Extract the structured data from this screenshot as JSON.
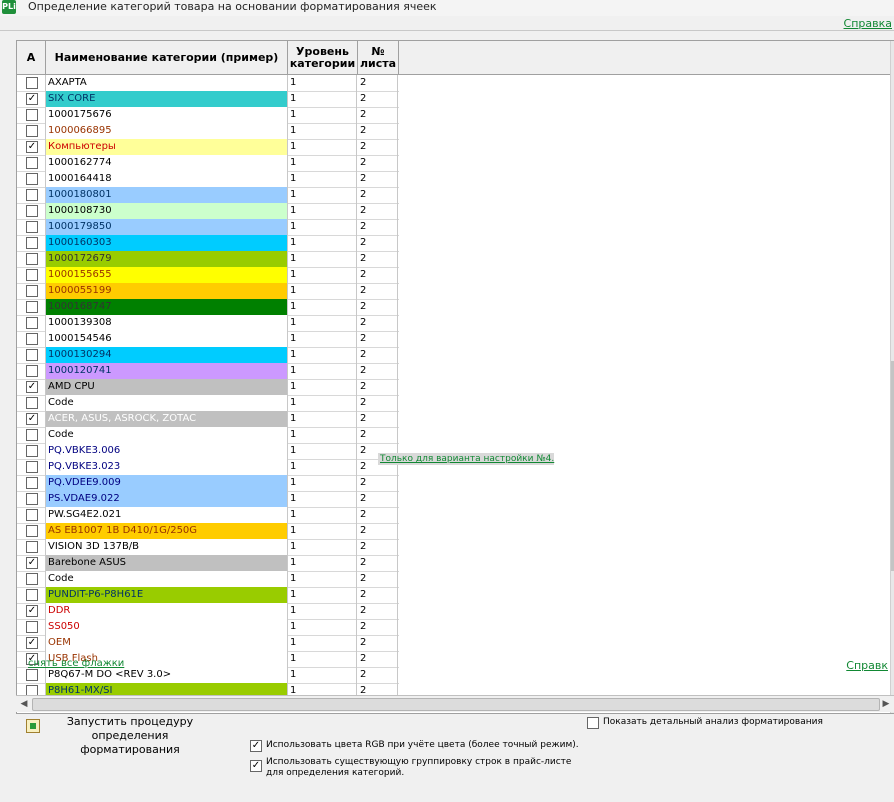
{
  "window": {
    "title": "Определение категорий товара на основании форматирования ячеек",
    "icon_text": "PLi"
  },
  "help_link_top": "Справка",
  "grid": {
    "columns": [
      {
        "label": "A"
      },
      {
        "label": "Наименование категории (пример)"
      },
      {
        "label": "Уровень категории"
      },
      {
        "label": "№ листа"
      }
    ],
    "rows": [
      {
        "checked": false,
        "name": "AXAPTA",
        "level": "1",
        "sheet": "2",
        "bg": "#ffffff",
        "fg": "#000000"
      },
      {
        "checked": true,
        "name": "SIX CORE",
        "level": "1",
        "sheet": "2",
        "bg": "#33cccc",
        "fg": "#003366"
      },
      {
        "checked": false,
        "name": "1000175676",
        "level": "1",
        "sheet": "2",
        "bg": "#ffffff",
        "fg": "#000000"
      },
      {
        "checked": false,
        "name": "1000066895",
        "level": "1",
        "sheet": "2",
        "bg": "#ffffff",
        "fg": "#993300"
      },
      {
        "checked": true,
        "name": "Компьютеры",
        "level": "1",
        "sheet": "2",
        "bg": "#ffff99",
        "fg": "#cc0000"
      },
      {
        "checked": false,
        "name": "1000162774",
        "level": "1",
        "sheet": "2",
        "bg": "#ffffff",
        "fg": "#000000"
      },
      {
        "checked": false,
        "name": "1000164418",
        "level": "1",
        "sheet": "2",
        "bg": "#ffffff",
        "fg": "#000000"
      },
      {
        "checked": false,
        "name": "1000180801",
        "level": "1",
        "sheet": "2",
        "bg": "#99ccff",
        "fg": "#003366"
      },
      {
        "checked": false,
        "name": "1000108730",
        "level": "1",
        "sheet": "2",
        "bg": "#ccffcc",
        "fg": "#000000"
      },
      {
        "checked": false,
        "name": "1000179850",
        "level": "1",
        "sheet": "2",
        "bg": "#99ccff",
        "fg": "#003366"
      },
      {
        "checked": false,
        "name": "1000160303",
        "level": "1",
        "sheet": "2",
        "bg": "#00ccff",
        "fg": "#003366"
      },
      {
        "checked": false,
        "name": "1000172679",
        "level": "1",
        "sheet": "2",
        "bg": "#99cc00",
        "fg": "#333333"
      },
      {
        "checked": false,
        "name": "1000155655",
        "level": "1",
        "sheet": "2",
        "bg": "#ffff00",
        "fg": "#993300"
      },
      {
        "checked": false,
        "name": "1000055199",
        "level": "1",
        "sheet": "2",
        "bg": "#ffcc00",
        "fg": "#993300"
      },
      {
        "checked": false,
        "name": "1000168747",
        "level": "1",
        "sheet": "2",
        "bg": "#008000",
        "fg": "#333333"
      },
      {
        "checked": false,
        "name": "1000139308",
        "level": "1",
        "sheet": "2",
        "bg": "#ffffff",
        "fg": "#000000"
      },
      {
        "checked": false,
        "name": "1000154546",
        "level": "1",
        "sheet": "2",
        "bg": "#ffffff",
        "fg": "#000000"
      },
      {
        "checked": false,
        "name": "1000130294",
        "level": "1",
        "sheet": "2",
        "bg": "#00ccff",
        "fg": "#003366"
      },
      {
        "checked": false,
        "name": "1000120741",
        "level": "1",
        "sheet": "2",
        "bg": "#cc99ff",
        "fg": "#003366"
      },
      {
        "checked": true,
        "name": "AMD CPU",
        "level": "1",
        "sheet": "2",
        "bg": "#c0c0c0",
        "fg": "#000000"
      },
      {
        "checked": false,
        "name": "Code",
        "level": "1",
        "sheet": "2",
        "bg": "#ffffff",
        "fg": "#000000"
      },
      {
        "checked": true,
        "name": "ACER, ASUS, ASROCK, ZOTAC",
        "level": "1",
        "sheet": "2",
        "bg": "#c0c0c0",
        "fg": "#ffffff"
      },
      {
        "checked": false,
        "name": "Code",
        "level": "1",
        "sheet": "2",
        "bg": "#ffffff",
        "fg": "#000000"
      },
      {
        "checked": false,
        "name": "PQ.VBKE3.006",
        "level": "1",
        "sheet": "2",
        "bg": "#ffffff",
        "fg": "#000080"
      },
      {
        "checked": false,
        "name": "PQ.VBKE3.023",
        "level": "1",
        "sheet": "2",
        "bg": "#ffffff",
        "fg": "#000080"
      },
      {
        "checked": false,
        "name": "PQ.VDEE9.009",
        "level": "1",
        "sheet": "2",
        "bg": "#99ccff",
        "fg": "#000080"
      },
      {
        "checked": false,
        "name": "PS.VDAE9.022",
        "level": "1",
        "sheet": "2",
        "bg": "#99ccff",
        "fg": "#000080"
      },
      {
        "checked": false,
        "name": "PW.SG4E2.021",
        "level": "1",
        "sheet": "2",
        "bg": "#ffffff",
        "fg": "#000000"
      },
      {
        "checked": false,
        "name": "AS EB1007 1B D410/1G/250G",
        "level": "1",
        "sheet": "2",
        "bg": "#ffcc00",
        "fg": "#993300"
      },
      {
        "checked": false,
        "name": "VISION 3D 137B/B",
        "level": "1",
        "sheet": "2",
        "bg": "#ffffff",
        "fg": "#000000"
      },
      {
        "checked": true,
        "name": "Barebone ASUS",
        "level": "1",
        "sheet": "2",
        "bg": "#c0c0c0",
        "fg": "#000000"
      },
      {
        "checked": false,
        "name": "Code",
        "level": "1",
        "sheet": "2",
        "bg": "#ffffff",
        "fg": "#000000"
      },
      {
        "checked": false,
        "name": "PUNDIT-P6-P8H61E",
        "level": "1",
        "sheet": "2",
        "bg": "#99cc00",
        "fg": "#003366"
      },
      {
        "checked": true,
        "name": "DDR",
        "level": "1",
        "sheet": "2",
        "bg": "#ffffff",
        "fg": "#cc0000"
      },
      {
        "checked": false,
        "name": "SS050",
        "level": "1",
        "sheet": "2",
        "bg": "#ffffff",
        "fg": "#cc0000"
      },
      {
        "checked": true,
        "name": "OEM",
        "level": "1",
        "sheet": "2",
        "bg": "#ffffff",
        "fg": "#993300"
      },
      {
        "checked": true,
        "name": "USB Flash",
        "level": "1",
        "sheet": "2",
        "bg": "#ffffff",
        "fg": "#993300"
      },
      {
        "checked": false,
        "name": "P8Q67-M DO <REV 3.0>",
        "level": "1",
        "sheet": "2",
        "bg": "#ffffff",
        "fg": "#000000"
      },
      {
        "checked": false,
        "name": "P8H61-MX/SI",
        "level": "1",
        "sheet": "2",
        "bg": "#99cc00",
        "fg": "#003366"
      }
    ]
  },
  "note_banner": "Только для варианта настройки №4.",
  "uncheck_all_link": "снять все флажки",
  "help_link_bottom": "Справк",
  "footer": {
    "run_button_label": "Запустить процедуру определения форматирования",
    "options": [
      {
        "checked": false,
        "label": "Показать детальный анализ форматирования"
      },
      {
        "checked": true,
        "label": "Использовать цвета RGB при учёте цвета (более точный режим)."
      },
      {
        "checked": true,
        "label": "Использовать существующую группировку строк в прайс-листе для определения категорий."
      }
    ]
  }
}
